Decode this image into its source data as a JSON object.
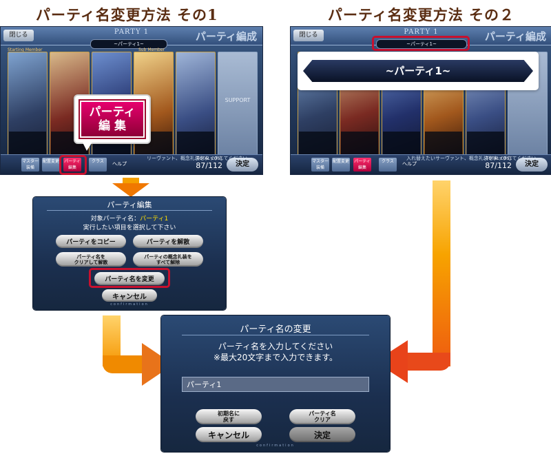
{
  "headings": {
    "method1": "パーティ名変更方法 その1",
    "method2": "パーティ名変更方法 その２"
  },
  "party_screen": {
    "close_label": "閉じる",
    "party_label": "PARTY 1",
    "title": "パーティ編成",
    "party_name": "~パーティ1~",
    "starting_member_label": "Starting Member",
    "sub_member_label": "Sub Member",
    "support_label": "SUPPORT",
    "total_cost_label": "TOTAL COST",
    "total_cost": "87/112",
    "decide_label": "決定",
    "help_label": "ヘルプ",
    "bottom_buttons": [
      "マスター装備",
      "配置変更",
      "パーティ編集",
      "クラス"
    ],
    "notice": "リーヴァント、概念礼装をタッチしてください",
    "notice2": "入れ替えたいサーヴァント、概念礼装をタッチしてください"
  },
  "callout_party_edit": "パーティ\n編 集",
  "namebar_large": "~パーティ1~",
  "party_edit_dialog": {
    "title": "パーティ編集",
    "target_label": "対象パーティ名：",
    "target_value": "パーティ1",
    "instruction": "実行したい項目を選択して下さい",
    "copy_button": "パーティをコピー",
    "disband_button": "パーティを解散",
    "clear_name_button": "パーティ名を\nクリアして解散",
    "remove_ce_button": "パーティの概念礼装を\nすべて解除",
    "rename_button": "パーティ名を変更",
    "cancel_button": "キャンセル",
    "footer_text": "confirmation"
  },
  "rename_dialog": {
    "title": "パーティ名の変更",
    "instruction1": "パーティ名を入力してください",
    "instruction2": "※最大20文字まで入力できます。",
    "input_value": "パーティ1",
    "default_name_button": "初期名に\n戻す",
    "clear_name_button": "パーティ名\nクリア",
    "cancel_button": "キャンセル",
    "decide_button": "決定",
    "footer_text": "confirmation"
  },
  "colors": {
    "heading": "#5a2d12",
    "highlight_red": "#c8102e",
    "arrow_orange": "#f7a300",
    "arrow_red": "#e8431a"
  }
}
